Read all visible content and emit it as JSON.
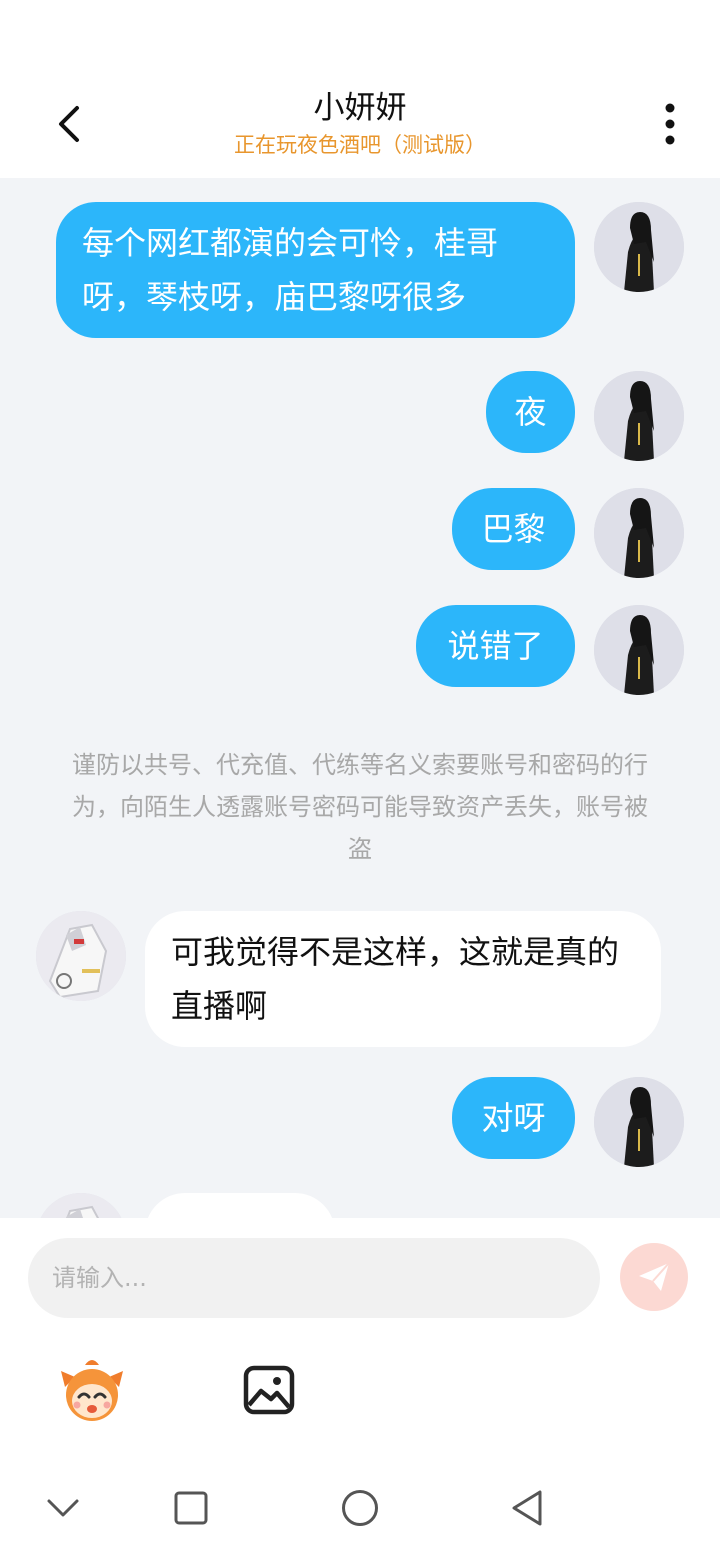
{
  "header": {
    "title": "小妍妍",
    "subtitle": "正在玩夜色酒吧（测试版）"
  },
  "messages": [
    {
      "side": "sent",
      "text": "每个网红都演的会可怜，桂哥呀，琴枝呀，庙巴黎呀很多"
    },
    {
      "side": "sent",
      "text": "夜"
    },
    {
      "side": "sent",
      "text": "巴黎"
    },
    {
      "side": "sent",
      "text": "说错了"
    },
    {
      "side": "recv",
      "text": "可我觉得不是这样，这就是真的直播啊"
    },
    {
      "side": "sent",
      "text": "对呀"
    }
  ],
  "notice": "谨防以共号、代充值、代练等名义索要账号和密码的行为，向陌生人透露账号密码可能导致资产丢失，账号被盗",
  "input": {
    "placeholder": "请输入..."
  },
  "icons": {
    "back": "chevron-left-icon",
    "more": "more-vertical-icon",
    "send": "paper-plane-icon",
    "sticker": "cartoon-face-icon",
    "image": "image-icon",
    "nav_back": "chevron-down-icon",
    "nav_recent": "square-icon",
    "nav_home": "circle-icon",
    "nav_return": "triangle-left-icon"
  },
  "colors": {
    "sent_bubble": "#2cb6fa",
    "recv_bubble": "#ffffff",
    "chat_background": "#f2f4f7",
    "subtitle": "#e8962d",
    "send_button": "#fcd9d3"
  }
}
